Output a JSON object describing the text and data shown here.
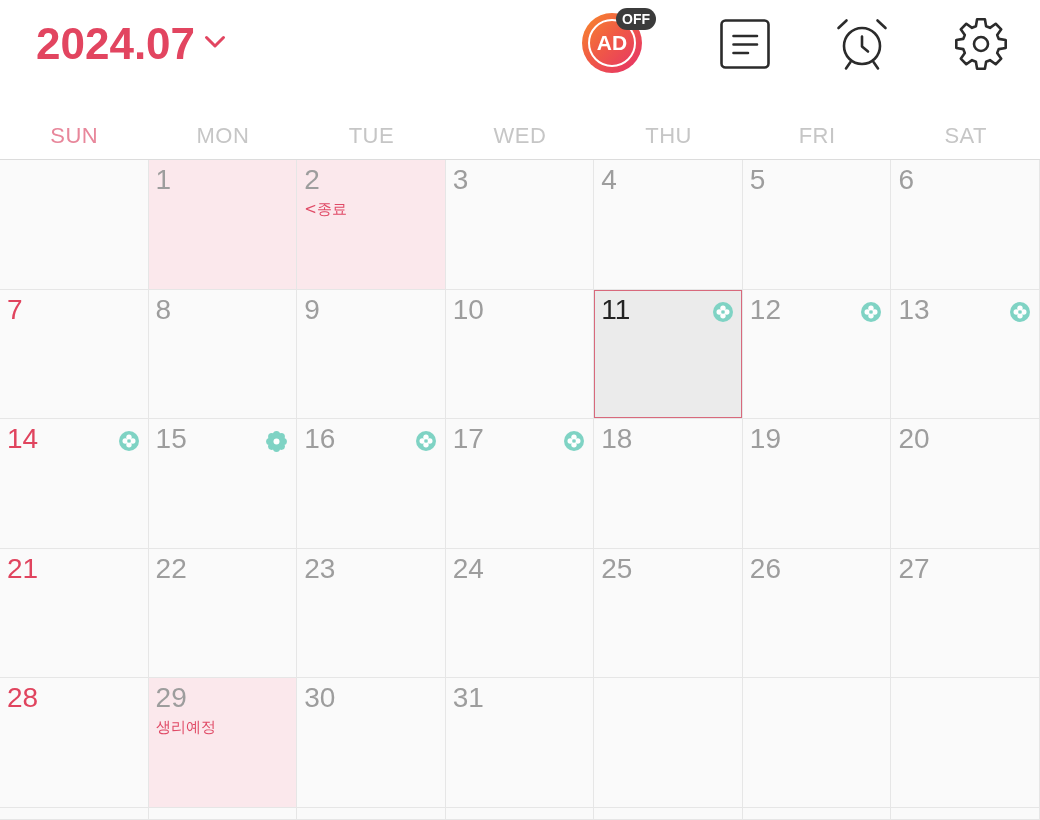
{
  "header": {
    "title": "2024.07",
    "ad_label": "AD",
    "ad_status": "OFF"
  },
  "weekdays": [
    {
      "label": "SUN",
      "sunday": true
    },
    {
      "label": "MON",
      "sunday": false
    },
    {
      "label": "TUE",
      "sunday": false
    },
    {
      "label": "WED",
      "sunday": false
    },
    {
      "label": "THU",
      "sunday": false
    },
    {
      "label": "FRI",
      "sunday": false
    },
    {
      "label": "SAT",
      "sunday": false
    }
  ],
  "weeks": [
    [
      {
        "kind": "blank"
      },
      {
        "kind": "day",
        "day": "1",
        "today": false,
        "highlighted": true
      },
      {
        "kind": "day",
        "day": "2",
        "today": false,
        "highlighted": true,
        "note": "<종료"
      },
      {
        "kind": "day",
        "day": "3",
        "today": false,
        "highlighted": false
      },
      {
        "kind": "day",
        "day": "4",
        "today": false,
        "highlighted": false
      },
      {
        "kind": "day",
        "day": "5",
        "today": false,
        "highlighted": false
      },
      {
        "kind": "day",
        "day": "6",
        "today": false,
        "highlighted": false
      }
    ],
    [
      {
        "kind": "day",
        "day": "7",
        "today": false,
        "highlighted": false
      },
      {
        "kind": "day",
        "day": "8",
        "today": false,
        "highlighted": false
      },
      {
        "kind": "day",
        "day": "9",
        "today": false,
        "highlighted": false
      },
      {
        "kind": "day",
        "day": "10",
        "today": false,
        "highlighted": false
      },
      {
        "kind": "day",
        "day": "11",
        "today": true,
        "highlighted": false,
        "marker": {
          "kind": "clover"
        }
      },
      {
        "kind": "day",
        "day": "12",
        "today": false,
        "highlighted": false,
        "marker": {
          "kind": "clover"
        }
      },
      {
        "kind": "day",
        "day": "13",
        "today": false,
        "highlighted": false,
        "marker": {
          "kind": "clover"
        }
      }
    ],
    [
      {
        "kind": "day",
        "day": "14",
        "today": false,
        "highlighted": false,
        "marker": {
          "kind": "clover"
        }
      },
      {
        "kind": "day",
        "day": "15",
        "today": false,
        "highlighted": false,
        "marker": {
          "kind": "flower"
        }
      },
      {
        "kind": "day",
        "day": "16",
        "today": false,
        "highlighted": false,
        "marker": {
          "kind": "clover"
        }
      },
      {
        "kind": "day",
        "day": "17",
        "today": false,
        "highlighted": false,
        "marker": {
          "kind": "clover"
        }
      },
      {
        "kind": "day",
        "day": "18",
        "today": false,
        "highlighted": false
      },
      {
        "kind": "day",
        "day": "19",
        "today": false,
        "highlighted": false
      },
      {
        "kind": "day",
        "day": "20",
        "today": false,
        "highlighted": false
      }
    ],
    [
      {
        "kind": "day",
        "day": "21",
        "today": false,
        "highlighted": false
      },
      {
        "kind": "day",
        "day": "22",
        "today": false,
        "highlighted": false
      },
      {
        "kind": "day",
        "day": "23",
        "today": false,
        "highlighted": false
      },
      {
        "kind": "day",
        "day": "24",
        "today": false,
        "highlighted": false
      },
      {
        "kind": "day",
        "day": "25",
        "today": false,
        "highlighted": false
      },
      {
        "kind": "day",
        "day": "26",
        "today": false,
        "highlighted": false
      },
      {
        "kind": "day",
        "day": "27",
        "today": false,
        "highlighted": false
      }
    ],
    [
      {
        "kind": "day",
        "day": "28",
        "today": false,
        "highlighted": false
      },
      {
        "kind": "day",
        "day": "29",
        "today": false,
        "highlighted": true,
        "note": "생리예정"
      },
      {
        "kind": "day",
        "day": "30",
        "today": false,
        "highlighted": false
      },
      {
        "kind": "day",
        "day": "31",
        "today": false,
        "highlighted": false
      },
      {
        "kind": "blank"
      },
      {
        "kind": "blank"
      },
      {
        "kind": "blank"
      }
    ],
    [
      {
        "kind": "blank"
      },
      {
        "kind": "blank"
      },
      {
        "kind": "blank"
      },
      {
        "kind": "blank"
      },
      {
        "kind": "blank"
      },
      {
        "kind": "blank"
      },
      {
        "kind": "blank"
      }
    ]
  ]
}
